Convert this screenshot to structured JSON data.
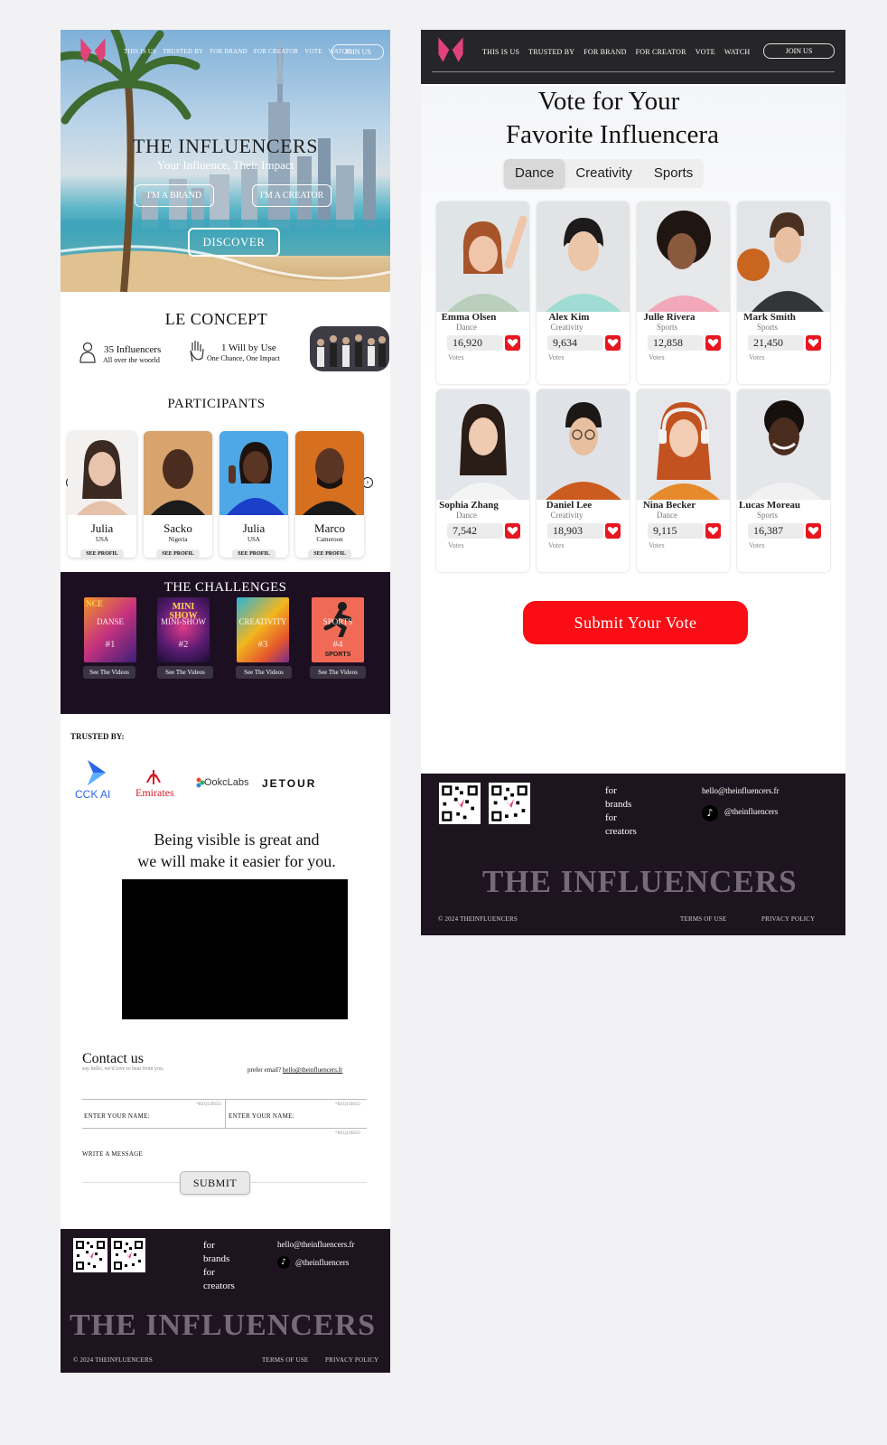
{
  "nav": {
    "links": [
      "THIS IS US",
      "TRUSTED BY",
      "FOR BRAND",
      "FOR CREATOR",
      "VOTE",
      "WATCH"
    ],
    "join": "JOIN US"
  },
  "hero": {
    "title": "THE INFLUENCERS",
    "subtitle": "Your Influence, Their Impact",
    "brand_btn": "I'M A BRAND",
    "creator_btn": "I'M A CREATOR",
    "discover": "DISCOVER"
  },
  "concept": {
    "title": "LE CONCEPT",
    "stat1_main": "35 Influencers",
    "stat1_sub": "All over the woorld",
    "stat2_main": "1 Will by Use",
    "stat2_sub": "One Chance, One Impact"
  },
  "participants": {
    "title": "PARTICIPANTS",
    "button": "SEE PROFIL",
    "items": [
      {
        "name": "Julia",
        "country": "USA"
      },
      {
        "name": "Sacko",
        "country": "Nigeria"
      },
      {
        "name": "Julia",
        "country": "USA"
      },
      {
        "name": "Marco",
        "country": "Cameroon"
      }
    ]
  },
  "challenges": {
    "title": "THE CHALLENGES",
    "button": "See The Videos",
    "items": [
      {
        "label": "DANSE",
        "num": "#1",
        "poster": "NCE"
      },
      {
        "label": "MINI-SHOW",
        "num": "#2",
        "poster": "MINI SHOW"
      },
      {
        "label": "CREATIVITY",
        "num": "#3",
        "poster": ""
      },
      {
        "label": "SPORTS",
        "num": "#4",
        "poster": "SPORTS"
      }
    ]
  },
  "trusted": {
    "title": "TRUSTED BY:",
    "logos": [
      "CCK AI",
      "Emirates",
      "OokcLabs",
      "JETOUR"
    ]
  },
  "visible": {
    "line1": "Being visible is great and",
    "line2": "we will make it easier for you."
  },
  "contact": {
    "title": "Contact us",
    "subtitle": "say hello, we'd love to hear from you.",
    "prefer": "prefer email?",
    "email": "hello@theinfluencers.fr",
    "name1": "ENTER YOUR NAME:",
    "name2": "ENTER YOUR NAME:",
    "required": "*REQUIRED",
    "message": "WRITE A MESSAGE",
    "submit": "SUBMIT"
  },
  "footer": {
    "for_lines": [
      "for",
      "brands",
      "for",
      "creators"
    ],
    "email": "hello@theinfluencers.fr",
    "social": "@theinfluencers",
    "brand": "THE INFLUENCERS",
    "copyright": "© 2024 THEINFLUENCERS",
    "terms": "TERMS OF USE",
    "privacy": "PRIVACY POLICY"
  },
  "vote": {
    "title_line1": "Vote for Your",
    "title_line2": "Favorite Influencera",
    "tabs": [
      "Dance",
      "Creativity",
      "Sports"
    ],
    "votes_label": "Votes",
    "submit": "Submit Your Vote",
    "candidates": [
      {
        "name": "Emma Olsen",
        "cat": "Dance",
        "votes": "16,920"
      },
      {
        "name": "Alex Kim",
        "cat": "Creativity",
        "votes": "9,634"
      },
      {
        "name": "Julle Rivera",
        "cat": "Sports",
        "votes": "12,858"
      },
      {
        "name": "Mark Smith",
        "cat": "Sports",
        "votes": "21,450"
      },
      {
        "name": "Sophia Zhang",
        "cat": "Dance",
        "votes": "7,542"
      },
      {
        "name": "Daniel Lee",
        "cat": "Creativity",
        "votes": "18,903"
      },
      {
        "name": "Nina Becker",
        "cat": "Dance",
        "votes": "9,115"
      },
      {
        "name": "Lucas Moreau",
        "cat": "Sports",
        "votes": "16,387"
      }
    ]
  },
  "colors": {
    "accent_red": "#fa0d14",
    "footer_bg": "#1e141f",
    "challenges_bg": "#1d0f22",
    "logo_pink": "#e0427a"
  }
}
